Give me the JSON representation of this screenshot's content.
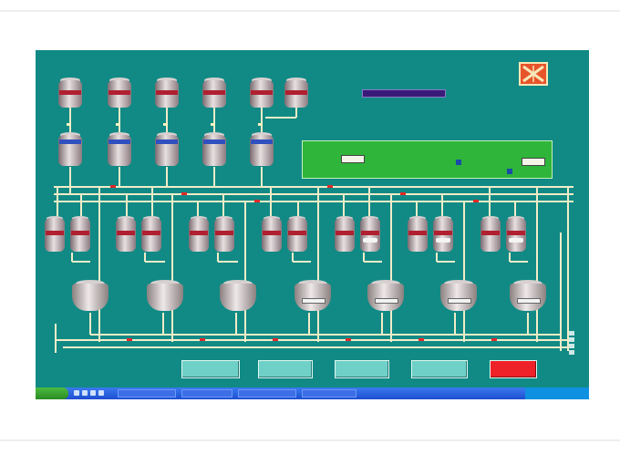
{
  "screen": {
    "topline": "",
    "id_label": "",
    "id_value": "",
    "subtext": ""
  },
  "control_panel": {
    "left_title": "",
    "right_title": "",
    "left_field": "",
    "right_field": "",
    "left_label": "",
    "right_label": ""
  },
  "buttons": [
    {
      "label": ""
    },
    {
      "label": ""
    },
    {
      "label": ""
    },
    {
      "label": ""
    },
    {
      "label": ""
    }
  ],
  "taskbar": {
    "start": "",
    "tasks": [
      "",
      "",
      "",
      ""
    ],
    "clock": ""
  },
  "colors": {
    "screen_bg": "#118a85",
    "panel_green": "#2eb53a",
    "alarm_red": "#ee2028",
    "pipe": "#f2ecc8"
  }
}
